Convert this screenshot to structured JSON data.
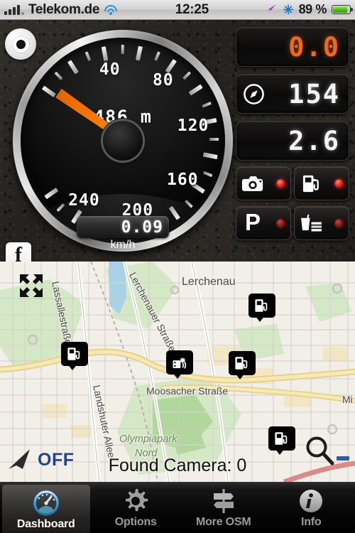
{
  "statusbar": {
    "signal_icon": "signal-bars-icon",
    "carrier": "Telekom.de",
    "wifi_icon": "wifi-icon",
    "clock": "12:25",
    "location_icon": "location-arrow-icon",
    "bluetooth_icon": "bluetooth-icon",
    "battery_percent": "89 %",
    "battery_icon": "battery-icon"
  },
  "dashboard": {
    "record_button": "record-button",
    "facebook_button": "f",
    "gauge": {
      "unit": "km/h",
      "digital_speed": "0.09",
      "altitude": "486 m",
      "scale_labels": [
        "40",
        "80",
        "120",
        "160",
        "200",
        "240"
      ],
      "scale_values": [
        40,
        80,
        120,
        160,
        200,
        240
      ],
      "scale_min": 0,
      "scale_max": 260,
      "needle_value": 0,
      "needle_color": "#f27100"
    },
    "panels": [
      {
        "name": "trip-readout",
        "icon": "",
        "value": "0.0",
        "color": "#f2681b"
      },
      {
        "name": "heading-readout",
        "icon": "compass-icon",
        "value": "154",
        "color": "#f4f4f4"
      },
      {
        "name": "distance-readout",
        "icon": "",
        "value": "2.6",
        "color": "#f4f4f4"
      }
    ],
    "poi_buttons": [
      {
        "name": "camera-poi-toggle",
        "icon": "camera-icon",
        "led": "on"
      },
      {
        "name": "fuel-poi-toggle",
        "icon": "fuel-pump-icon",
        "led": "on"
      },
      {
        "name": "parking-poi-toggle",
        "icon": "parking-p-icon",
        "label": "P",
        "led": "off"
      },
      {
        "name": "food-poi-toggle",
        "icon": "food-drink-icon",
        "led": "off"
      }
    ]
  },
  "map": {
    "expand_icon": "expand-arrows-icon",
    "magnify_icon": "magnifier-icon",
    "zoom_out_icon": "minus-icon",
    "compass_state": "OFF",
    "status_text": "Found Camera: 0",
    "labels": [
      {
        "text": "Lerchenau",
        "kind": "place"
      },
      {
        "text": "Lerchenauer Straße",
        "kind": "street"
      },
      {
        "text": "Lassallestraße",
        "kind": "street"
      },
      {
        "text": "Moosacher Straße",
        "kind": "street"
      },
      {
        "text": "Landshuter Allee",
        "kind": "street"
      },
      {
        "text": "Olympiapark",
        "kind": "park"
      },
      {
        "text": "Nord",
        "kind": "park"
      },
      {
        "text": "Mi",
        "kind": "street"
      }
    ],
    "markers": [
      {
        "type": "fuel-pump-icon",
        "name": "fuel-station-marker"
      },
      {
        "type": "fuel-pump-icon",
        "name": "fuel-station-marker"
      },
      {
        "type": "speed-camera-icon",
        "name": "speed-camera-marker"
      },
      {
        "type": "fuel-pump-icon",
        "name": "fuel-station-marker"
      },
      {
        "type": "fuel-pump-icon",
        "name": "fuel-station-marker"
      }
    ]
  },
  "tabbar": {
    "items": [
      {
        "label": "Dashboard",
        "icon": "gauge-icon",
        "active": true
      },
      {
        "label": "Options",
        "icon": "gear-icon",
        "active": false
      },
      {
        "label": "More OSM",
        "icon": "signpost-icon",
        "active": false
      },
      {
        "label": "Info",
        "icon": "info-icon",
        "active": false
      }
    ]
  }
}
